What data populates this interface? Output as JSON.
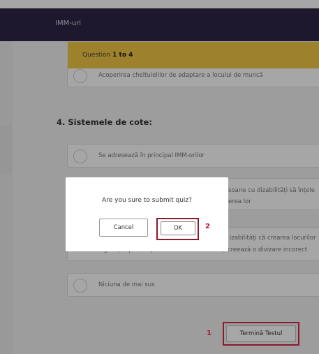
{
  "header": {
    "title": "IMM-uri"
  },
  "question_banner": {
    "prefix": "Question ",
    "range": "1 to 4"
  },
  "prev_question": {
    "options": [
      "Acoperirea cheltuielilor de adaptare a locului de muncă"
    ]
  },
  "question4": {
    "title": "4. Sistemele de cote:",
    "options": [
      {
        "line1": "Se adresează în principal IMM-urilor",
        "line2": ""
      },
      {
        "line1": "soane cu dizabilități să înțele",
        "line2": "erea lor"
      },
      {
        "line1": "izabilități că crearea locurilor",
        "line2": "legislației privind persoanele cu dizabilități creează o divizare incorect"
      },
      {
        "line1": "Niciuna de mai sus",
        "line2": ""
      }
    ]
  },
  "dialog": {
    "message": "Are you sure to submit quiz?",
    "cancel_label": "Cancel",
    "ok_label": "OK"
  },
  "footer": {
    "end_test_label": "Termină Testul"
  },
  "annotations": {
    "marker_end": "1",
    "marker_ok": "2",
    "highlight_color": "#8b1a2c"
  }
}
